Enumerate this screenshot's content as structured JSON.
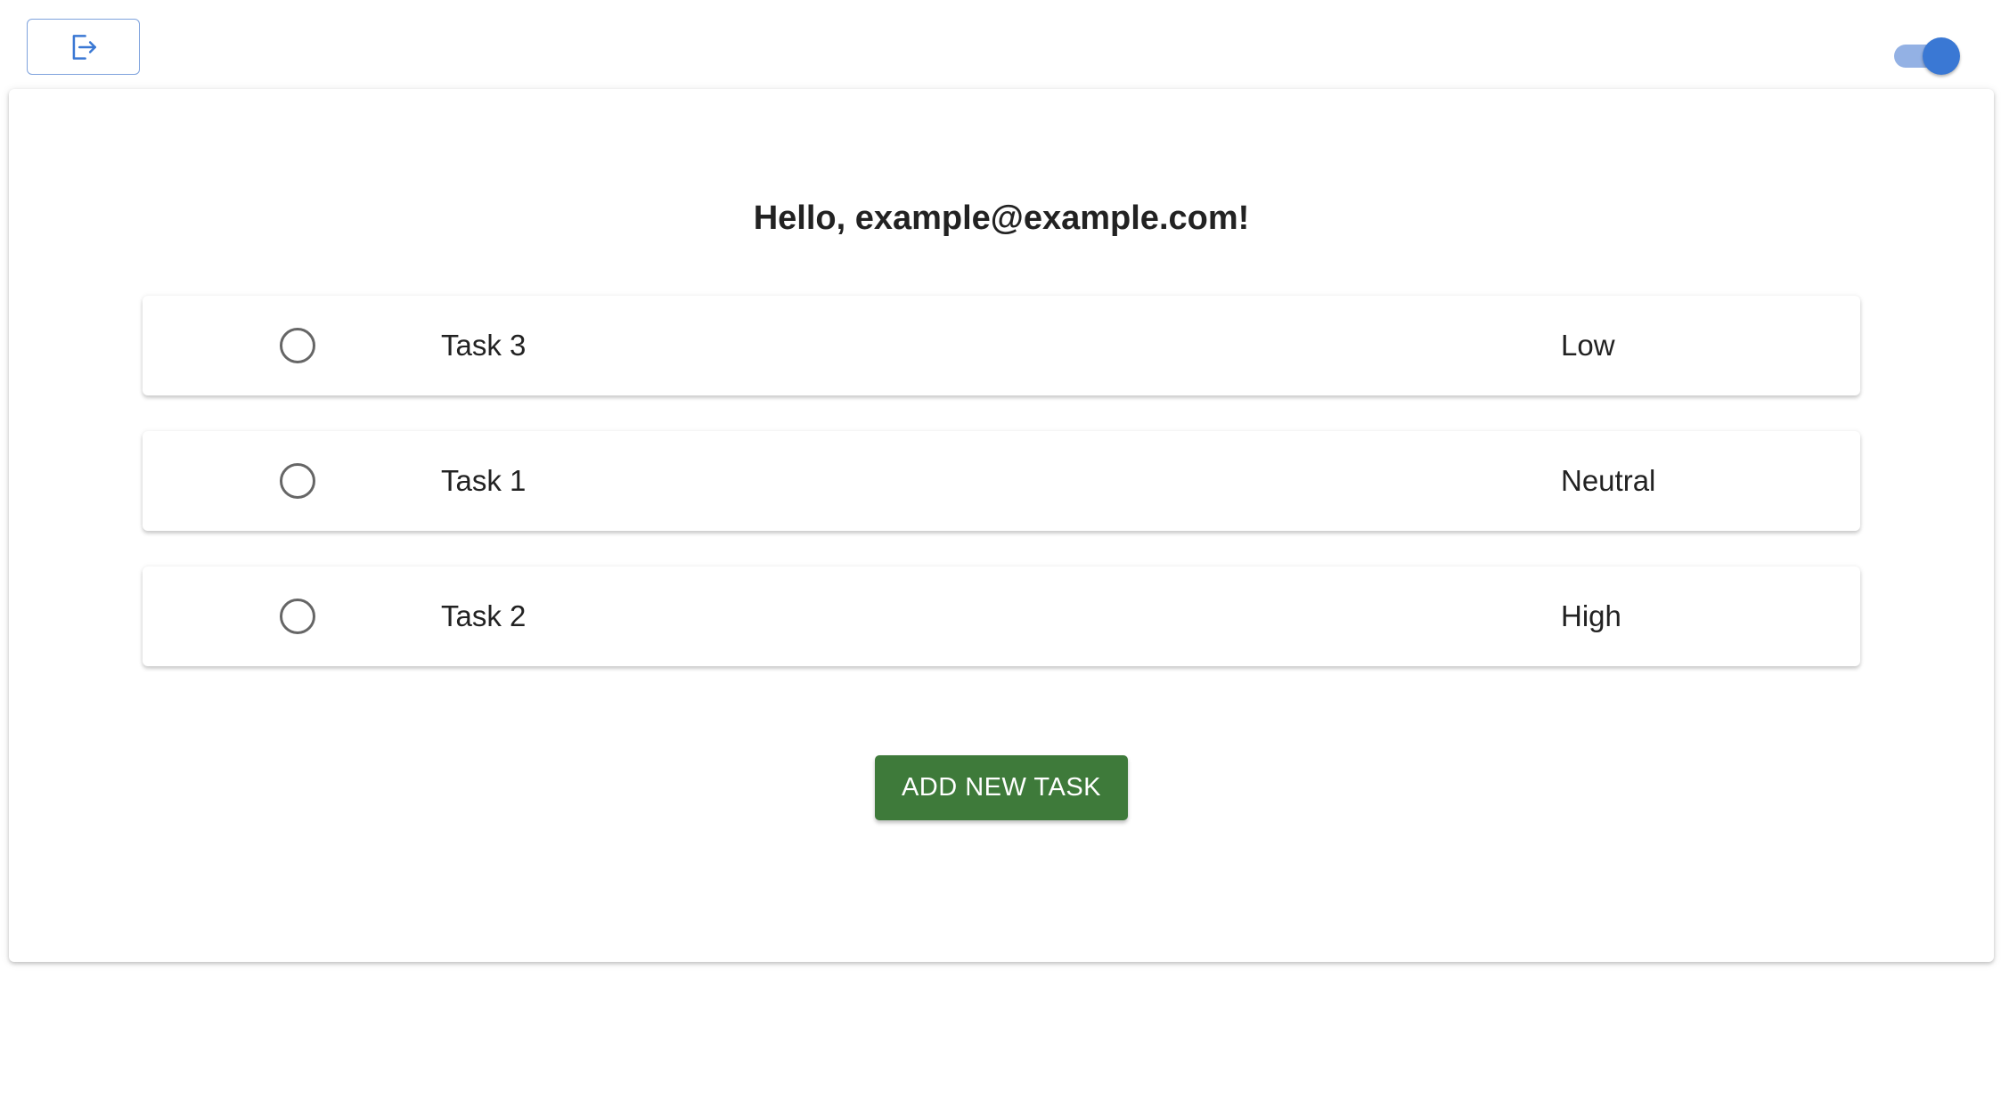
{
  "header": {
    "logout_icon": "logout-icon",
    "theme_toggle": {
      "state": "on",
      "color": "#3a78d4"
    }
  },
  "main": {
    "greeting": "Hello, example@example.com!",
    "tasks": [
      {
        "name": "Task 3",
        "priority": "Low",
        "completed": false
      },
      {
        "name": "Task 1",
        "priority": "Neutral",
        "completed": false
      },
      {
        "name": "Task 2",
        "priority": "High",
        "completed": false
      }
    ],
    "add_button_label": "ADD NEW TASK",
    "add_button_color": "#3e7a3a"
  }
}
